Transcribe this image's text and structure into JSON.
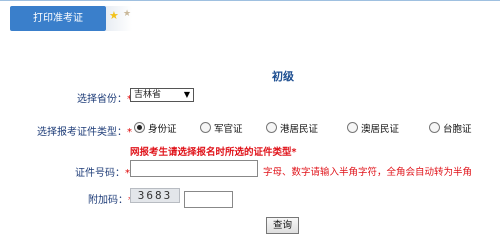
{
  "tab": {
    "label": "打印准考证"
  },
  "form": {
    "level": "初级",
    "province_label": "选择省份",
    "province_value": "吉林省",
    "required_mark": "*",
    "idtype_label": "选择报考证件类型",
    "idtype_options": [
      "身份证",
      "军官证",
      "港居民证",
      "澳居民证",
      "台胞证"
    ],
    "idtype_selected": "身份证",
    "warning": "网报考生请选择报名时所选的证件类型",
    "idnum_label": "证件号码",
    "idnum_value": "",
    "idnum_hint": "字母、数字请输入半角字符，全角会自动转为半角",
    "captcha_label": "附加码",
    "captcha_text": "3683",
    "captcha_value": "",
    "submit_label": "查询",
    "colon": "："
  }
}
